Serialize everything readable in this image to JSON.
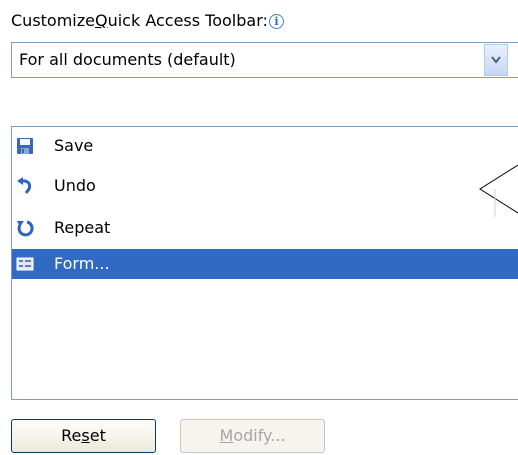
{
  "heading": {
    "text_before": "Customize ",
    "mnemonic": "Q",
    "text_after": "uick Access Toolbar:",
    "info_icon": "i"
  },
  "scope_select": {
    "value": "For all documents (default)",
    "icon": "chevron-down-icon"
  },
  "toolbar_list": {
    "items": [
      {
        "label": "Save",
        "icon": "save-icon",
        "selected": false
      },
      {
        "label": "Undo",
        "icon": "undo-icon",
        "selected": false
      },
      {
        "label": "Repeat",
        "icon": "repeat-icon",
        "selected": false
      },
      {
        "label": "Form...",
        "icon": "form-icon",
        "selected": true
      }
    ]
  },
  "buttons": {
    "reset": {
      "before": "Re",
      "mnemonic": "s",
      "after": "et"
    },
    "modify": {
      "before": "",
      "mnemonic": "M",
      "after": "odify..."
    }
  },
  "colors": {
    "selection": "#316ac5",
    "border": "#7f9db9",
    "disabled_text": "#a6a6a6"
  }
}
